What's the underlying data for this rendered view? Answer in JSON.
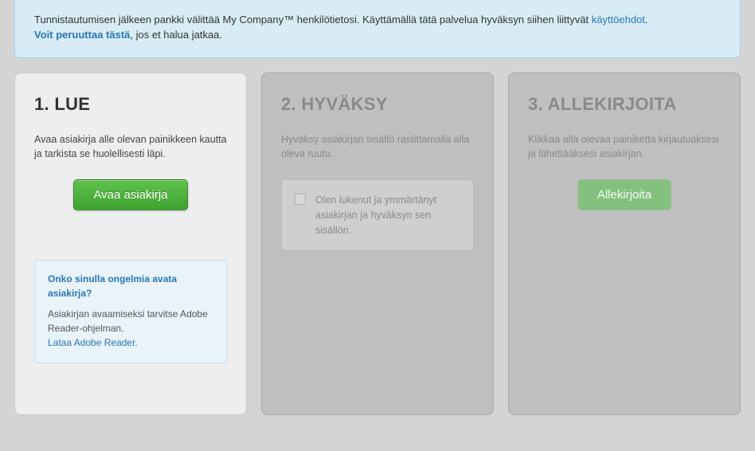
{
  "banner": {
    "text_before_terms": "Tunnistautumisen jälkeen pankki välittää My Company™ henkilötietosi. Käyttämällä tätä palvelua hyväksyn siihen liittyvät ",
    "terms_link": "käyttöehdot",
    "period": ".",
    "cancel_link": "Voit peruuttaa tästä",
    "text_after_cancel": ", jos et halua jatkaa."
  },
  "step1": {
    "title": "1. LUE",
    "desc": "Avaa asiakirja alle olevan painikkeen kautta ja tarkista se huolellisesti läpi.",
    "button": "Avaa asiakirja",
    "help": {
      "question": "Onko sinulla ongelmia avata asiakirja?",
      "body": "Asiakirjan avaamiseksi tarvitse Adobe Reader-ohjelman.",
      "link": "Lataa Adobe Reader."
    }
  },
  "step2": {
    "title": "2. HYVÄKSY",
    "desc": "Hyväksy asiakirjan sisältö rastittamalla alla oleva ruutu.",
    "checkbox_label": "Olen lukenut ja ymmärtänyt asiakirjan ja hyväksyn sen sisällön."
  },
  "step3": {
    "title": "3. ALLEKIRJOITA",
    "desc": "Klikkaa alla olevaa painiketta kirjautuaksesi ja lähettääksesi asiakirjan.",
    "button": "Allekirjoita"
  }
}
